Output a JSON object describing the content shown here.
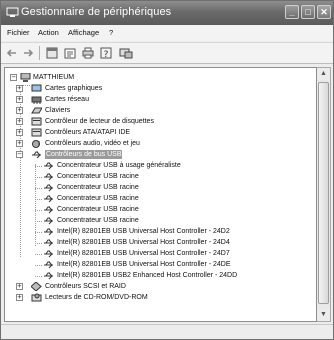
{
  "window": {
    "title": "Gestionnaire de périphériques"
  },
  "window_buttons": {
    "minimize": "_",
    "maximize": "□",
    "close": "✕"
  },
  "menu": [
    {
      "label": "Fichier"
    },
    {
      "label": "Action"
    },
    {
      "label": "Affichage"
    },
    {
      "label": "?"
    }
  ],
  "toolbar": {
    "buttons": [
      "back-icon",
      "forward-icon",
      "console-icon",
      "properties-icon",
      "print-icon",
      "help-icon",
      "scan-hardware-icon"
    ]
  },
  "tree": {
    "root": "MATTHIEUM",
    "categories_top": [
      {
        "label": "Cartes graphiques",
        "icon": "display-card-icon"
      },
      {
        "label": "Cartes réseau",
        "icon": "network-card-icon"
      },
      {
        "label": "Claviers",
        "icon": "keyboard-icon"
      },
      {
        "label": "Contrôleur de lecteur de disquettes",
        "icon": "floppy-controller-icon"
      },
      {
        "label": "Contrôleurs ATA/ATAPI IDE",
        "icon": "ide-controller-icon"
      },
      {
        "label": "Contrôleurs audio, vidéo et jeu",
        "icon": "audio-icon"
      }
    ],
    "usb_category": {
      "label": "Contrôleurs de bus USB",
      "icon": "usb-icon"
    },
    "usb_children": [
      "Concentrateur USB à usage généraliste",
      "Concentrateur USB racine",
      "Concentrateur USB racine",
      "Concentrateur USB racine",
      "Concentrateur USB racine",
      "Concentrateur USB racine",
      "Intel(R) 82801EB USB Universal Host Controller - 24D2",
      "Intel(R) 82801EB USB Universal Host Controller - 24D4",
      "Intel(R) 82801EB USB Universal Host Controller - 24D7",
      "Intel(R) 82801EB USB Universal Host Controller - 24DE",
      "Intel(R) 82801EB USB2 Enhanced Host Controller - 24DD"
    ],
    "categories_bottom": [
      {
        "label": "Contrôleurs SCSI et RAID",
        "icon": "scsi-icon"
      },
      {
        "label": "Lecteurs de CD-ROM/DVD-ROM",
        "icon": "cdrom-icon"
      }
    ]
  },
  "scrollbar": {
    "up": "▲",
    "down": "▼"
  },
  "colors": {
    "selection": "#9a9a9a",
    "titlebar": "#6a6a6a"
  }
}
